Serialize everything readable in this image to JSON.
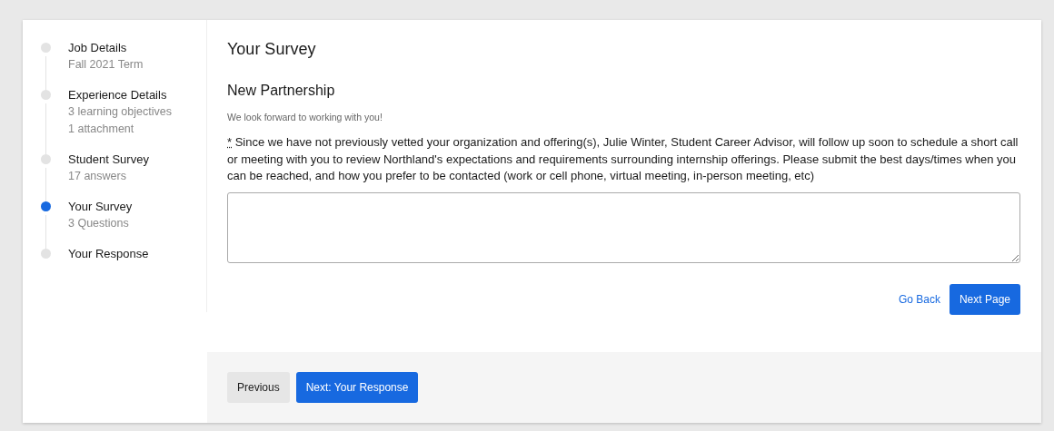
{
  "steps": [
    {
      "title": "Job Details",
      "details": [
        "Fall 2021 Term"
      ],
      "selected": false
    },
    {
      "title": "Experience Details",
      "details": [
        "3 learning objectives",
        "1 attachment"
      ],
      "selected": false
    },
    {
      "title": "Student Survey",
      "details": [
        "17 answers"
      ],
      "selected": false
    },
    {
      "title": "Your Survey",
      "details": [
        "3 Questions"
      ],
      "selected": true
    },
    {
      "title": "Your Response",
      "selected": false
    }
  ],
  "main": {
    "title": "Your Survey",
    "section_title": "New Partnership",
    "intro": "We look forward to working with you!",
    "question": {
      "required_mark": "*",
      "text": "Since we have not previously vetted your organization and offering(s), Julie Winter, Student Career Advisor, will follow up soon to schedule a short call or meeting with you to review Northland's expectations and requirements surrounding internship offerings. Please submit the best days/times when you can be reached, and how you prefer to be contacted (work or cell phone, virtual meeting, in-person meeting, etc)"
    },
    "go_back": "Go Back",
    "next_page": "Next Page"
  },
  "footer": {
    "previous": "Previous",
    "next": "Next: Your Response"
  }
}
